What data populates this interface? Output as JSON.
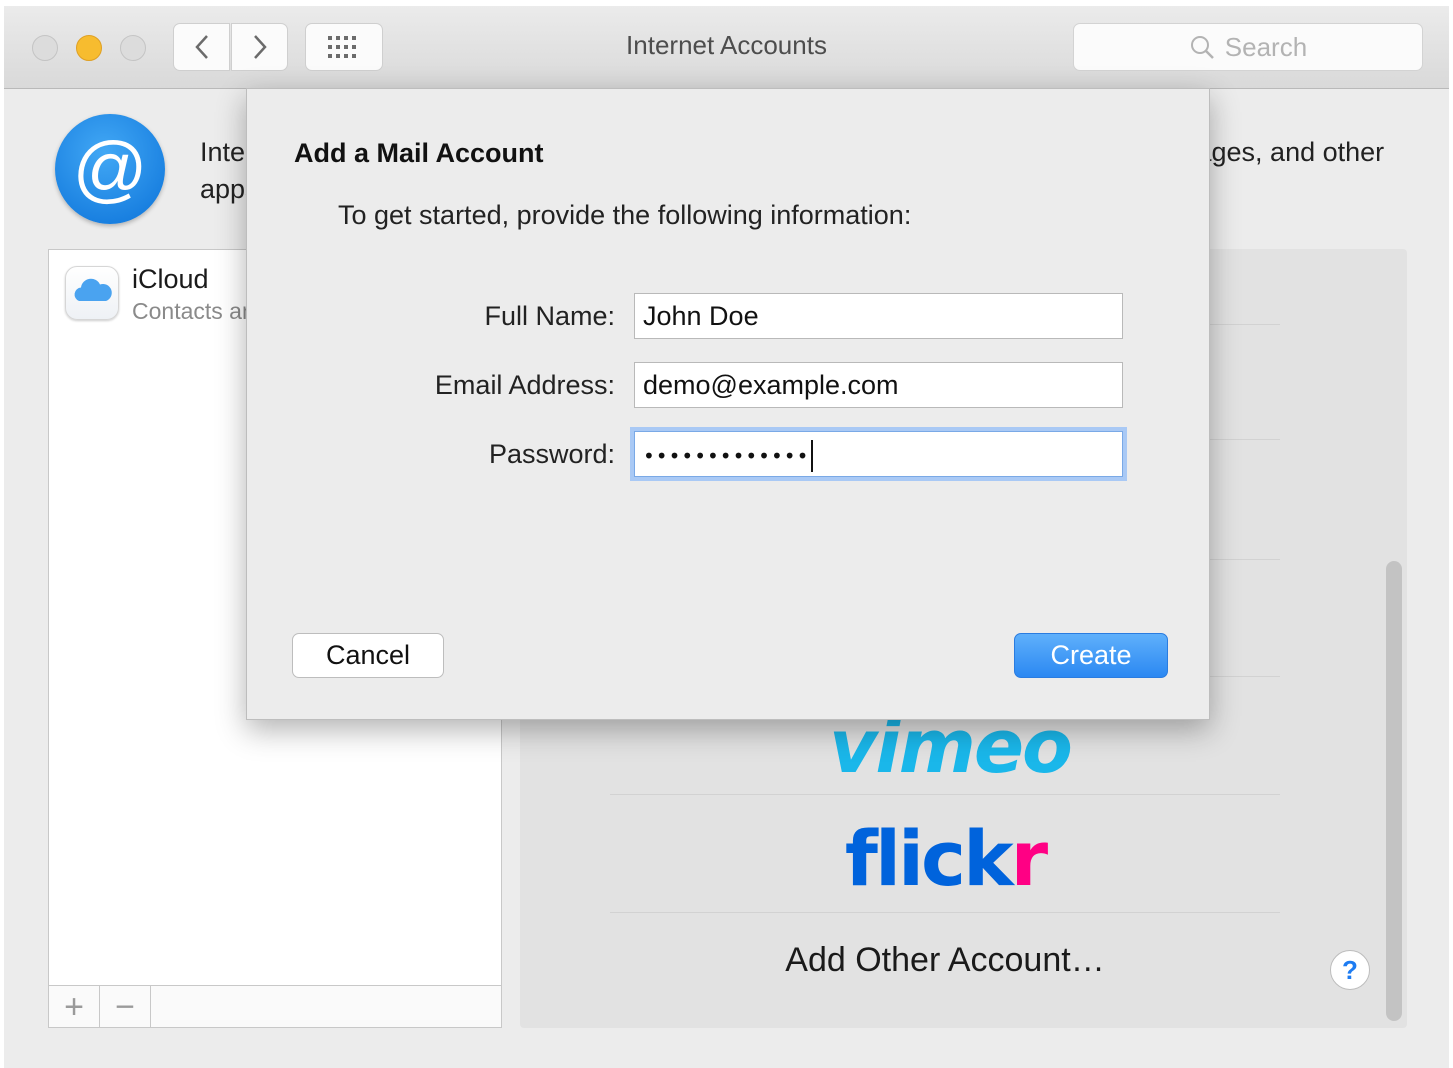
{
  "window": {
    "title": "Internet Accounts",
    "search_placeholder": "Search"
  },
  "header": {
    "description": "Internet Accounts sets up your accounts to use with Mail, Contacts, Calendar, Messages, and other apps."
  },
  "accounts": {
    "items": [
      {
        "name": "iCloud",
        "subtitle": "Contacts and 7 more"
      }
    ],
    "add_symbol": "+",
    "remove_symbol": "−"
  },
  "providers": {
    "vimeo_logo": "vimeo",
    "flickr_logo_a": "flick",
    "flickr_logo_b": "r",
    "add_other": "Add Other Account…",
    "help_symbol": "?"
  },
  "sheet": {
    "title": "Add a Mail Account",
    "instructions": "To get started, provide the following information:",
    "fields": {
      "full_name_label": "Full Name:",
      "full_name_value": "John Doe",
      "email_label": "Email Address:",
      "email_value": "demo@example.com",
      "password_label": "Password:",
      "password_value": "•••••••••••••"
    },
    "cancel_label": "Cancel",
    "create_label": "Create"
  },
  "colors": {
    "accent": "#2b88f2",
    "minimize": "#f7bc2f",
    "vimeo": "#1ab7ea",
    "flickr_blue": "#0063dc",
    "flickr_pink": "#ff0084"
  },
  "icons": [
    "close-icon",
    "minimize-icon",
    "zoom-icon",
    "chevron-left-icon",
    "chevron-right-icon",
    "grid-icon",
    "search-icon",
    "at-sign-icon",
    "icloud-icon",
    "help-icon"
  ]
}
